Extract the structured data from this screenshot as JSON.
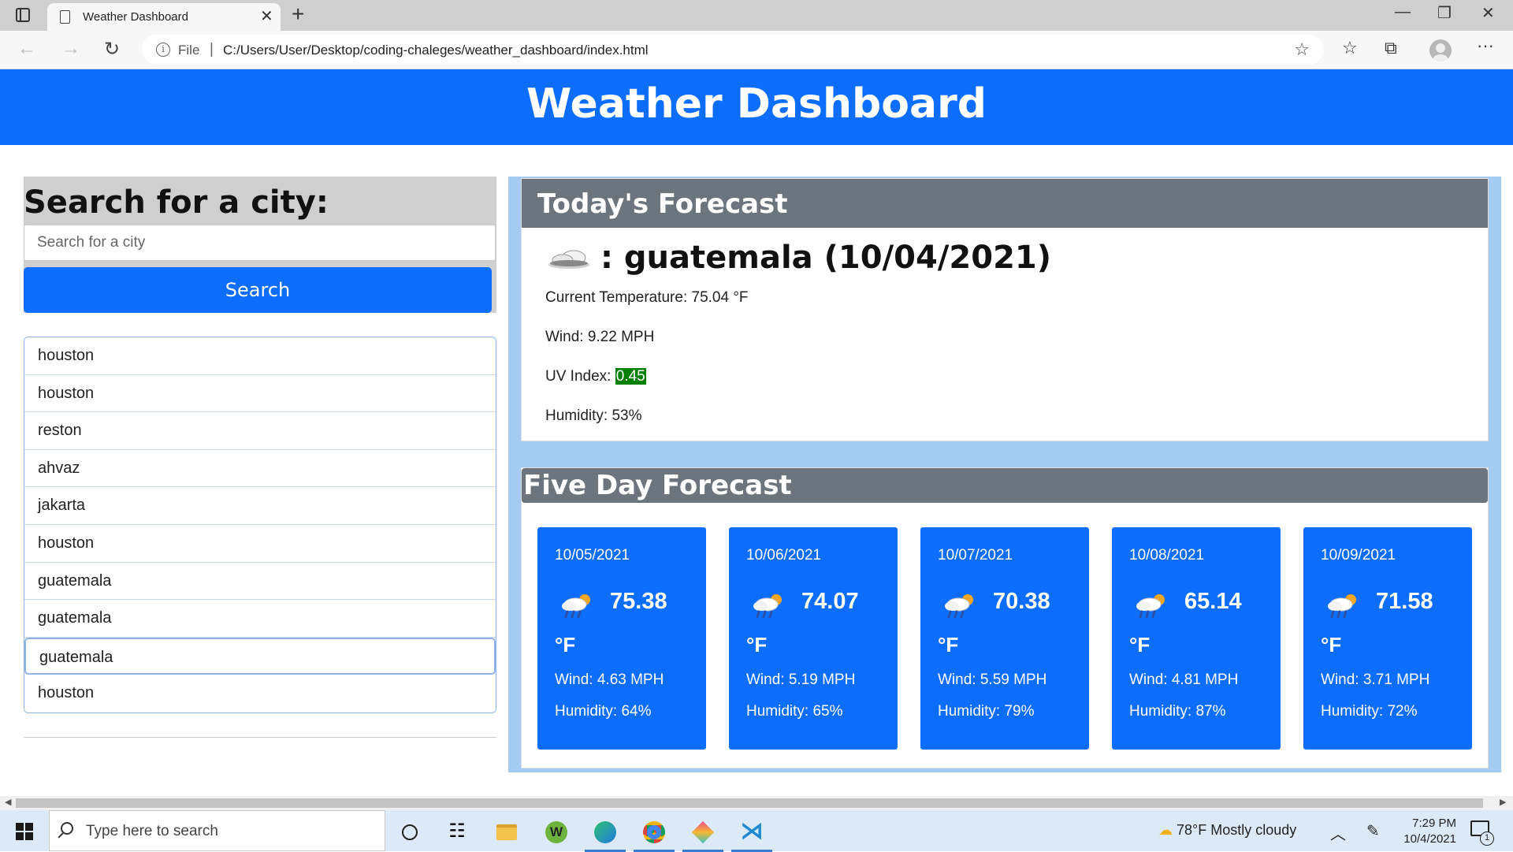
{
  "browser": {
    "tab_title": "Weather Dashboard",
    "url_scheme_label": "File",
    "url": "C:/Users/User/Desktop/coding-chaleges/weather_dashboard/index.html"
  },
  "header": {
    "title": "Weather Dashboard"
  },
  "search": {
    "heading": "Search for a city:",
    "placeholder": "Search for a city",
    "button_label": "Search"
  },
  "history": [
    "houston",
    "houston",
    "reston",
    "ahvaz",
    "jakarta",
    "houston",
    "guatemala",
    "guatemala",
    "guatemala",
    "houston"
  ],
  "today": {
    "heading": "Today's Forecast",
    "icon": "partly-cloudy-icon",
    "city_line": ": guatemala (10/04/2021)",
    "temperature": "Current Temperature: 75.04 °F",
    "wind": "Wind: 9.22 MPH",
    "uv_label": "UV Index:",
    "uv_value": "0.45",
    "uv_color": "#008000",
    "humidity": "Humidity: 53%"
  },
  "five_day": {
    "heading": "Five Day Forecast",
    "days": [
      {
        "date": "10/05/2021",
        "icon": "rain-sun-icon",
        "temp": "75.38",
        "unit": "°F",
        "wind": "Wind: 4.63 MPH",
        "humidity": "Humidity: 64%"
      },
      {
        "date": "10/06/2021",
        "icon": "rain-sun-icon",
        "temp": "74.07",
        "unit": "°F",
        "wind": "Wind: 5.19 MPH",
        "humidity": "Humidity: 65%"
      },
      {
        "date": "10/07/2021",
        "icon": "rain-sun-icon",
        "temp": "70.38",
        "unit": "°F",
        "wind": "Wind: 5.59 MPH",
        "humidity": "Humidity: 79%"
      },
      {
        "date": "10/08/2021",
        "icon": "rain-sun-icon",
        "temp": "65.14",
        "unit": "°F",
        "wind": "Wind: 4.81 MPH",
        "humidity": "Humidity: 87%"
      },
      {
        "date": "10/09/2021",
        "icon": "rain-sun-icon",
        "temp": "71.58",
        "unit": "°F",
        "wind": "Wind: 3.71 MPH",
        "humidity": "Humidity: 72%"
      }
    ]
  },
  "colors": {
    "primary": "#0d6efd",
    "card_header": "#6c757d",
    "panel_bg": "#a6cbf2"
  },
  "taskbar": {
    "search_placeholder": "Type here to search",
    "weather": "78°F  Mostly cloudy",
    "time": "7:29 PM",
    "date": "10/4/2021",
    "notification_count": "1"
  }
}
